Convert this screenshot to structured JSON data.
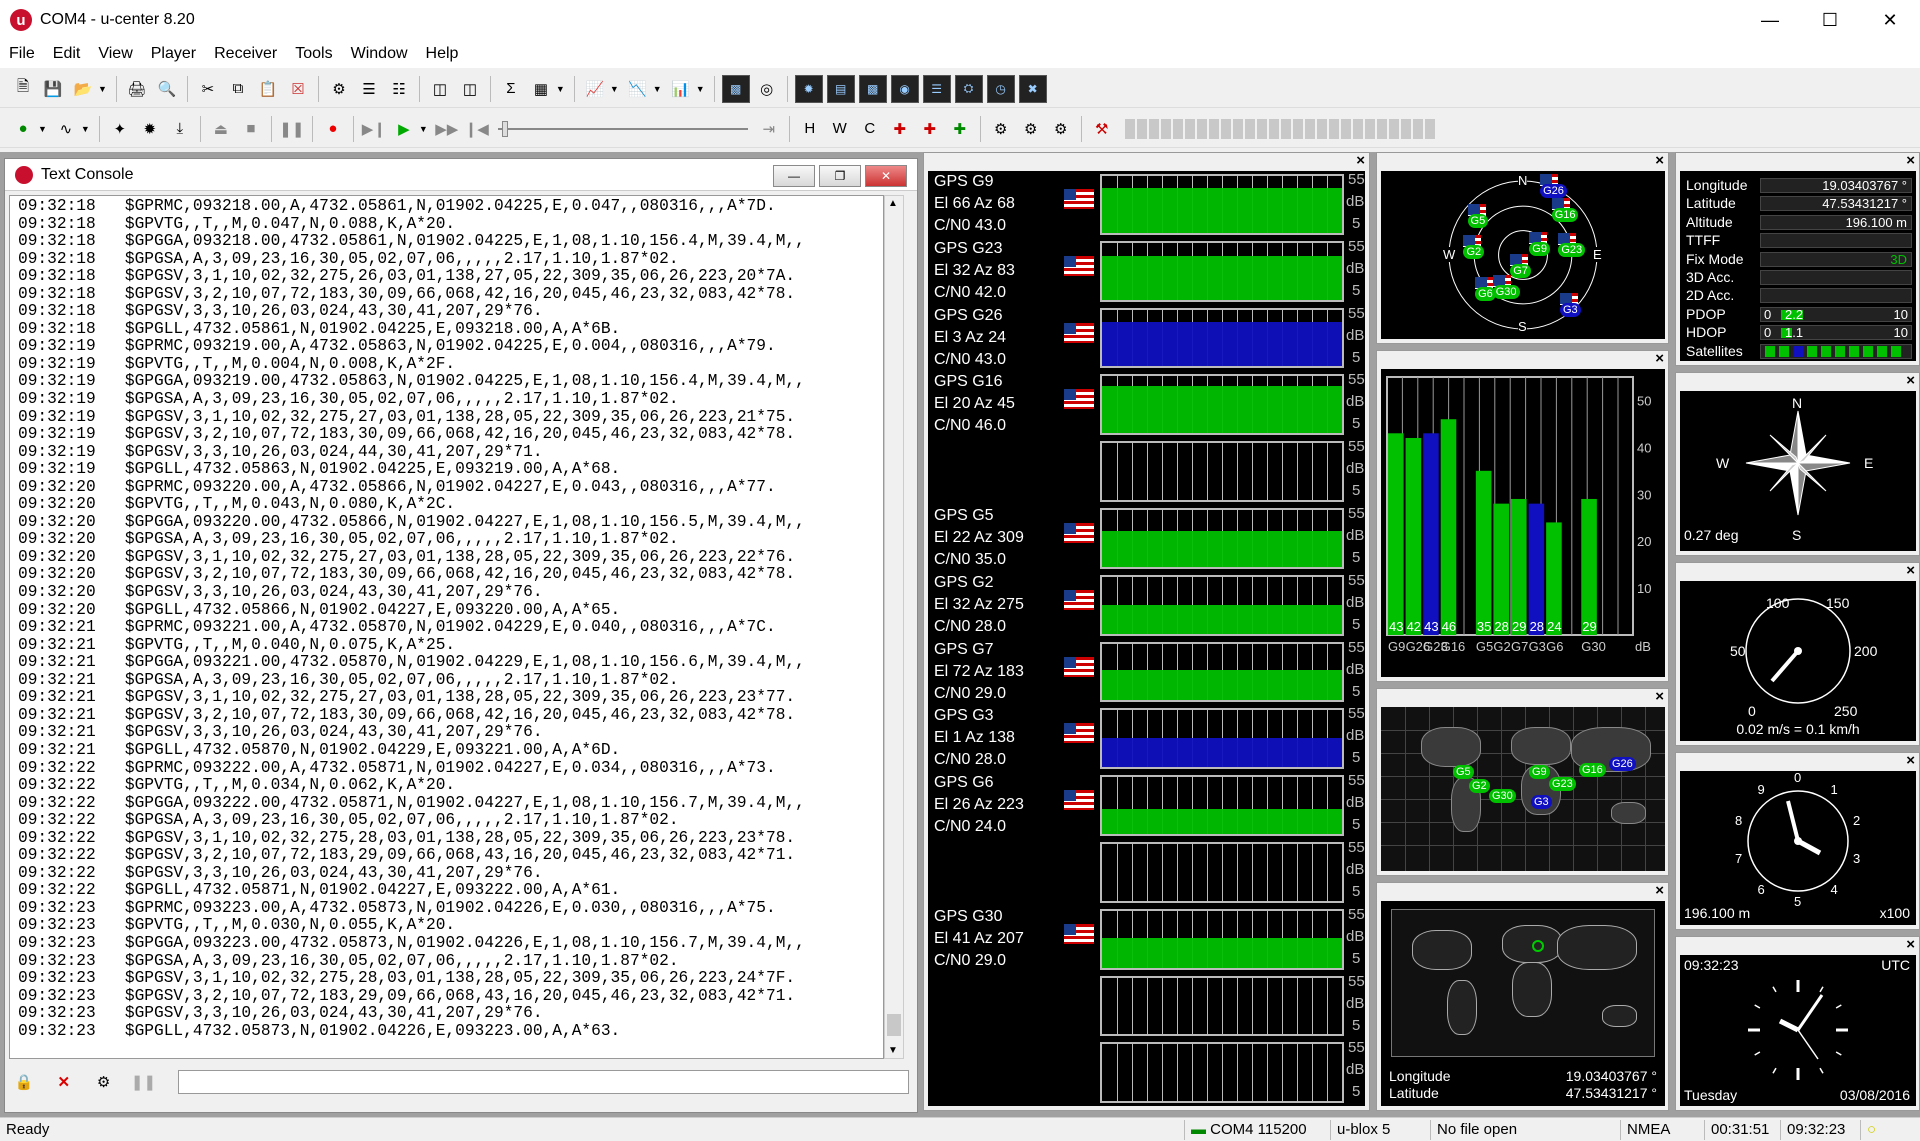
{
  "window": {
    "title": "COM4 - u-center 8.20",
    "logo": "u"
  },
  "menu": [
    "File",
    "Edit",
    "View",
    "Player",
    "Receiver",
    "Tools",
    "Window",
    "Help"
  ],
  "console": {
    "title": "Text Console",
    "lines": [
      "09:32:18   $GPRMC,093218.00,A,4732.05861,N,01902.04225,E,0.047,,080316,,,A*7D.",
      "09:32:18   $GPVTG,,T,,M,0.047,N,0.088,K,A*20.",
      "09:32:18   $GPGGA,093218.00,4732.05861,N,01902.04225,E,1,08,1.10,156.4,M,39.4,M,,",
      "09:32:18   $GPGSA,A,3,09,23,16,30,05,02,07,06,,,,,2.17,1.10,1.87*02.",
      "09:32:18   $GPGSV,3,1,10,02,32,275,26,03,01,138,27,05,22,309,35,06,26,223,20*7A.",
      "09:32:18   $GPGSV,3,2,10,07,72,183,30,09,66,068,42,16,20,045,46,23,32,083,42*78.",
      "09:32:18   $GPGSV,3,3,10,26,03,024,43,30,41,207,29*76.",
      "09:32:18   $GPGLL,4732.05861,N,01902.04225,E,093218.00,A,A*6B.",
      "09:32:19   $GPRMC,093219.00,A,4732.05863,N,01902.04225,E,0.004,,080316,,,A*79.",
      "09:32:19   $GPVTG,,T,,M,0.004,N,0.008,K,A*2F.",
      "09:32:19   $GPGGA,093219.00,4732.05863,N,01902.04225,E,1,08,1.10,156.4,M,39.4,M,,",
      "09:32:19   $GPGSA,A,3,09,23,16,30,05,02,07,06,,,,,2.17,1.10,1.87*02.",
      "09:32:19   $GPGSV,3,1,10,02,32,275,27,03,01,138,28,05,22,309,35,06,26,223,21*75.",
      "09:32:19   $GPGSV,3,2,10,07,72,183,30,09,66,068,42,16,20,045,46,23,32,083,42*78.",
      "09:32:19   $GPGSV,3,3,10,26,03,024,44,30,41,207,29*71.",
      "09:32:19   $GPGLL,4732.05863,N,01902.04225,E,093219.00,A,A*68.",
      "09:32:20   $GPRMC,093220.00,A,4732.05866,N,01902.04227,E,0.043,,080316,,,A*77.",
      "09:32:20   $GPVTG,,T,,M,0.043,N,0.080,K,A*2C.",
      "09:32:20   $GPGGA,093220.00,4732.05866,N,01902.04227,E,1,08,1.10,156.5,M,39.4,M,,",
      "09:32:20   $GPGSA,A,3,09,23,16,30,05,02,07,06,,,,,2.17,1.10,1.87*02.",
      "09:32:20   $GPGSV,3,1,10,02,32,275,27,03,01,138,28,05,22,309,35,06,26,223,22*76.",
      "09:32:20   $GPGSV,3,2,10,07,72,183,30,09,66,068,42,16,20,045,46,23,32,083,42*78.",
      "09:32:20   $GPGSV,3,3,10,26,03,024,43,30,41,207,29*76.",
      "09:32:20   $GPGLL,4732.05866,N,01902.04227,E,093220.00,A,A*65.",
      "09:32:21   $GPRMC,093221.00,A,4732.05870,N,01902.04229,E,0.040,,080316,,,A*7C.",
      "09:32:21   $GPVTG,,T,,M,0.040,N,0.075,K,A*25.",
      "09:32:21   $GPGGA,093221.00,4732.05870,N,01902.04229,E,1,08,1.10,156.6,M,39.4,M,,",
      "09:32:21   $GPGSA,A,3,09,23,16,30,05,02,07,06,,,,,2.17,1.10,1.87*02.",
      "09:32:21   $GPGSV,3,1,10,02,32,275,27,03,01,138,28,05,22,309,35,06,26,223,23*77.",
      "09:32:21   $GPGSV,3,2,10,07,72,183,30,09,66,068,42,16,20,045,46,23,32,083,42*78.",
      "09:32:21   $GPGSV,3,3,10,26,03,024,43,30,41,207,29*76.",
      "09:32:21   $GPGLL,4732.05870,N,01902.04229,E,093221.00,A,A*6D.",
      "09:32:22   $GPRMC,093222.00,A,4732.05871,N,01902.04227,E,0.034,,080316,,,A*73.",
      "09:32:22   $GPVTG,,T,,M,0.034,N,0.062,K,A*20.",
      "09:32:22   $GPGGA,093222.00,4732.05871,N,01902.04227,E,1,08,1.10,156.7,M,39.4,M,,",
      "09:32:22   $GPGSA,A,3,09,23,16,30,05,02,07,06,,,,,2.17,1.10,1.87*02.",
      "09:32:22   $GPGSV,3,1,10,02,32,275,28,03,01,138,28,05,22,309,35,06,26,223,23*78.",
      "09:32:22   $GPGSV,3,2,10,07,72,183,29,09,66,068,43,16,20,045,46,23,32,083,42*71.",
      "09:32:22   $GPGSV,3,3,10,26,03,024,43,30,41,207,29*76.",
      "09:32:22   $GPGLL,4732.05871,N,01902.04227,E,093222.00,A,A*61.",
      "09:32:23   $GPRMC,093223.00,A,4732.05873,N,01902.04226,E,0.030,,080316,,,A*75.",
      "09:32:23   $GPVTG,,T,,M,0.030,N,0.055,K,A*20.",
      "09:32:23   $GPGGA,093223.00,4732.05873,N,01902.04226,E,1,08,1.10,156.7,M,39.4,M,,",
      "09:32:23   $GPGSA,A,3,09,23,16,30,05,02,07,06,,,,,2.17,1.10,1.87*02.",
      "09:32:23   $GPGSV,3,1,10,02,32,275,28,03,01,138,28,05,22,309,35,06,26,223,24*7F.",
      "09:32:23   $GPGSV,3,2,10,07,72,183,29,09,66,068,43,16,20,045,46,23,32,083,42*71.",
      "09:32:23   $GPGSV,3,3,10,26,03,024,43,30,41,207,29*76.",
      "09:32:23   $GPGLL,4732.05873,N,01902.04226,E,093223.00,A,A*63."
    ]
  },
  "signal_rows": [
    {
      "sv": "GPS G9",
      "pos": "El 66 Az 68",
      "cn0": "C/N0 43.0",
      "level": 43,
      "color": "green",
      "flag": true
    },
    {
      "sv": "GPS G23",
      "pos": "El 32 Az 83",
      "cn0": "C/N0 42.0",
      "level": 42,
      "color": "green",
      "flag": true
    },
    {
      "sv": "GPS G26",
      "pos": "El 3 Az 24",
      "cn0": "C/N0 43.0",
      "level": 43,
      "color": "blue",
      "flag": true
    },
    {
      "sv": "GPS G16",
      "pos": "El 20 Az 45",
      "cn0": "C/N0 46.0",
      "level": 46,
      "color": "green",
      "flag": true
    },
    {
      "sv": "",
      "pos": "",
      "cn0": "",
      "level": 0,
      "color": "none",
      "flag": false
    },
    {
      "sv": "GPS G5",
      "pos": "El 22 Az 309",
      "cn0": "C/N0 35.0",
      "level": 35,
      "color": "green",
      "flag": true
    },
    {
      "sv": "GPS G2",
      "pos": "El 32 Az 275",
      "cn0": "C/N0 28.0",
      "level": 28,
      "color": "green",
      "flag": true
    },
    {
      "sv": "GPS G7",
      "pos": "El 72 Az 183",
      "cn0": "C/N0 29.0",
      "level": 29,
      "color": "green",
      "flag": true
    },
    {
      "sv": "GPS G3",
      "pos": "El 1 Az 138",
      "cn0": "C/N0 28.0",
      "level": 28,
      "color": "blue",
      "flag": true
    },
    {
      "sv": "GPS G6",
      "pos": "El 26 Az 223",
      "cn0": "C/N0 24.0",
      "level": 24,
      "color": "green",
      "flag": true
    },
    {
      "sv": "",
      "pos": "",
      "cn0": "",
      "level": 0,
      "color": "none",
      "flag": false
    },
    {
      "sv": "GPS G30",
      "pos": "El 41 Az 207",
      "cn0": "C/N0 29.0",
      "level": 29,
      "color": "green",
      "flag": true
    },
    {
      "sv": "",
      "pos": "",
      "cn0": "",
      "level": 0,
      "color": "none",
      "flag": false
    },
    {
      "sv": "",
      "pos": "",
      "cn0": "",
      "level": 0,
      "color": "none",
      "flag": false
    }
  ],
  "signal_scale": {
    "top": "55",
    "unit": "dB",
    "bottom": "5"
  },
  "sky": {
    "N": "N",
    "E": "E",
    "S": "S",
    "W": "W",
    "sats": [
      {
        "name": "G26",
        "az": 24,
        "el": 3,
        "color": "blue"
      },
      {
        "name": "G16",
        "az": 45,
        "el": 20,
        "color": "green"
      },
      {
        "name": "G23",
        "az": 83,
        "el": 32,
        "color": "green"
      },
      {
        "name": "G9",
        "az": 68,
        "el": 66,
        "color": "green"
      },
      {
        "name": "G5",
        "az": 309,
        "el": 22,
        "color": "green"
      },
      {
        "name": "G2",
        "az": 275,
        "el": 32,
        "color": "green"
      },
      {
        "name": "G7",
        "az": 183,
        "el": 72,
        "color": "green"
      },
      {
        "name": "G30",
        "az": 207,
        "el": 41,
        "color": "green"
      },
      {
        "name": "G6",
        "az": 223,
        "el": 26,
        "color": "green"
      },
      {
        "name": "G3",
        "az": 138,
        "el": 1,
        "color": "blue"
      }
    ]
  },
  "chart_data": {
    "type": "bar",
    "categories": [
      "G9",
      "G26",
      "G23",
      "G16",
      "G5",
      "G2",
      "G7",
      "G3",
      "G6",
      "G30"
    ],
    "values": [
      43,
      42,
      43,
      46,
      35,
      28,
      29,
      28,
      24,
      29
    ],
    "colors": [
      "#00c000",
      "#00c000",
      "#1010c0",
      "#00c000",
      "#00c000",
      "#00c000",
      "#00c000",
      "#1010c0",
      "#00c000",
      "#00c000"
    ],
    "tick_labels": [
      "50",
      "40",
      "30",
      "20",
      "10"
    ],
    "ylabel": "dB",
    "ylim": [
      0,
      55
    ],
    "x_labels": [
      "G9",
      "G26",
      "G23",
      "G16",
      "G5",
      "G2",
      "G7",
      "G3",
      "G6",
      "G30"
    ],
    "value_labels": [
      "43",
      "42",
      "43",
      "46",
      "35",
      "28",
      "29",
      "28",
      "24",
      "29"
    ]
  },
  "map_sats": [
    "G5",
    "G2",
    "G30",
    "G9",
    "G23",
    "G16",
    "G26",
    "G3"
  ],
  "nav_map": {
    "lon_label": "Longitude",
    "lon": "19.03403767 °",
    "lat_label": "Latitude",
    "lat": "47.53431217 °"
  },
  "info": [
    {
      "label": "Longitude",
      "value": "19.03403767 °"
    },
    {
      "label": "Latitude",
      "value": "47.53431217 °"
    },
    {
      "label": "Altitude",
      "value": "196.100 m"
    },
    {
      "label": "TTFF",
      "value": ""
    },
    {
      "label": "Fix Mode",
      "value": "3D"
    },
    {
      "label": "3D Acc.",
      "value": ""
    },
    {
      "label": "2D Acc.",
      "value": ""
    },
    {
      "label": "PDOP",
      "value": "0",
      "v2": "2.2",
      "v3": "10",
      "level": 0.22
    },
    {
      "label": "HDOP",
      "value": "0",
      "v2": "1.1",
      "v3": "10",
      "level": 0.11
    },
    {
      "label": "Satellites",
      "value": ""
    }
  ],
  "compass": {
    "heading": "0.27 deg",
    "N": "N",
    "E": "E",
    "S": "S",
    "W": "W"
  },
  "speedo": {
    "marks": [
      "0",
      "50",
      "100",
      "150",
      "200",
      "250"
    ],
    "readout": "0.02 m/s = 0.1 km/h",
    "level": 0
  },
  "altimeter": {
    "marks": [
      "0",
      "1",
      "2",
      "3",
      "4",
      "5",
      "6",
      "7",
      "8",
      "9"
    ],
    "readout": "196.100 m",
    "scale": "x100"
  },
  "clock": {
    "time": "09:32:23",
    "zone": "UTC",
    "day": "Tuesday",
    "date": "03/08/2016"
  },
  "status": {
    "ready": "Ready",
    "port": "COM4 115200",
    "device": "u-blox 5",
    "file": "No file open",
    "protocol": "NMEA",
    "elapsed": "00:31:51",
    "time": "09:32:23"
  },
  "colors": {
    "brand": "#c8102e",
    "green": "#00c000",
    "blue": "#1010c0"
  }
}
